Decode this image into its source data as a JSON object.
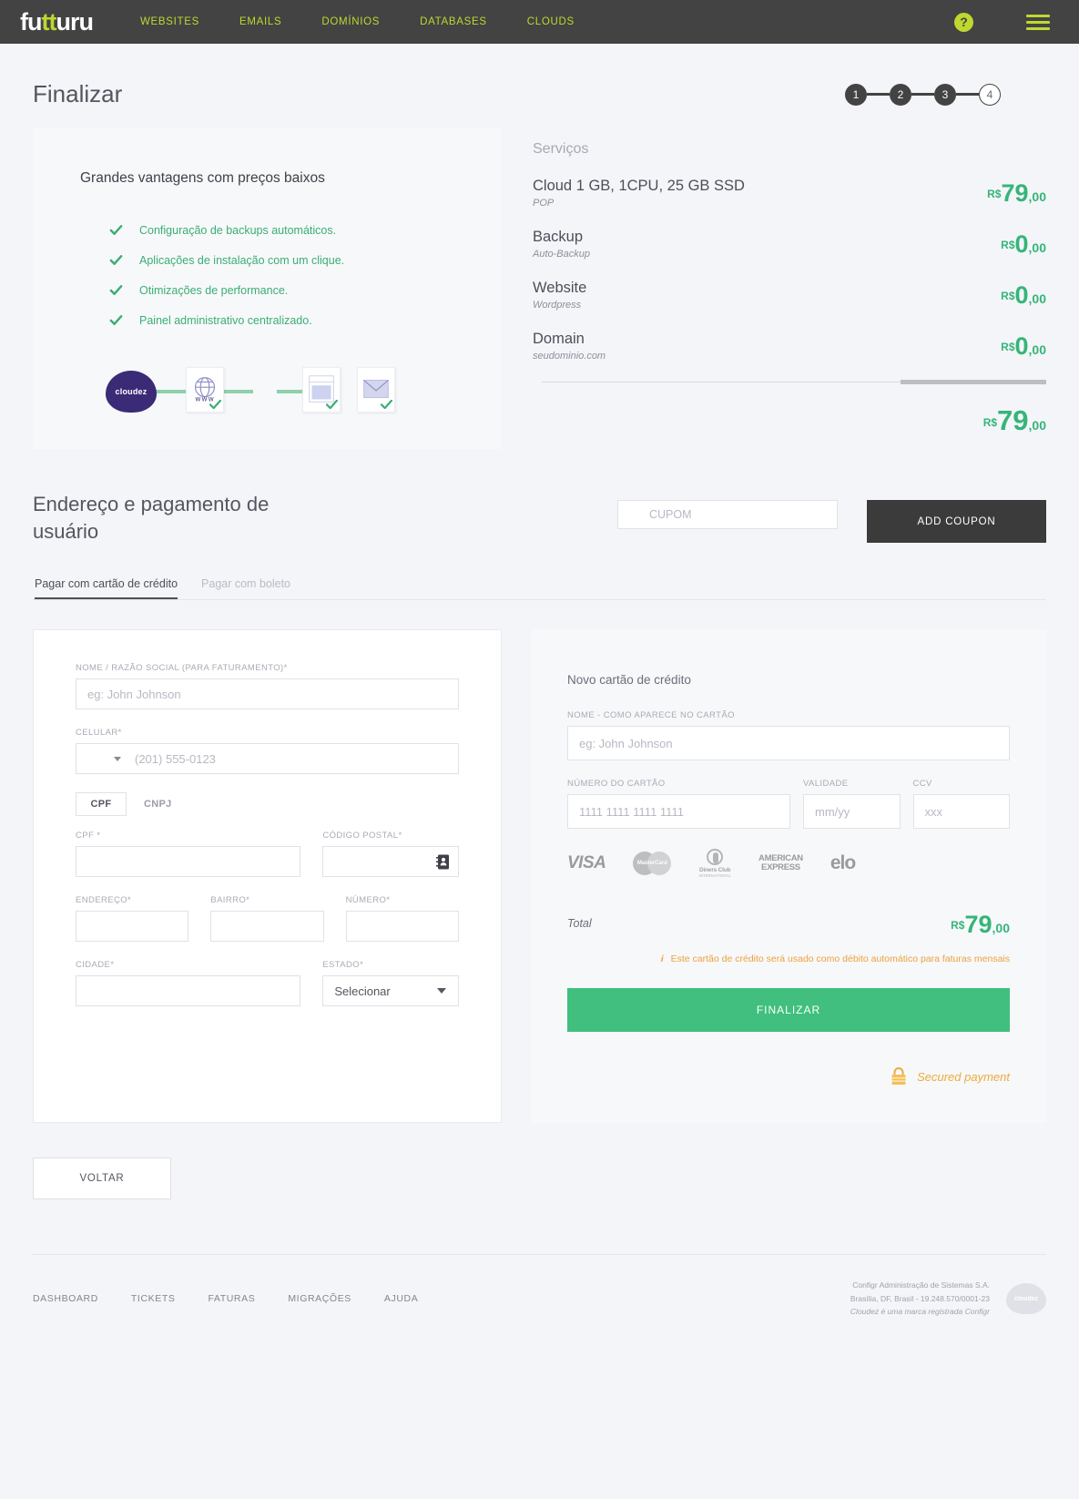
{
  "nav": {
    "logo_parts": {
      "a": "fu",
      "b": "tt",
      "c": "uru"
    },
    "links": [
      "WEBSITES",
      "EMAILS",
      "DOMÍNIOS",
      "DATABASES",
      "CLOUDS"
    ],
    "help_glyph": "?"
  },
  "page": {
    "title": "Finalizar",
    "steps": [
      "1",
      "2",
      "3",
      "4"
    ],
    "active_steps": 3
  },
  "promo": {
    "heading": "Grandes vantagens com preços baixos",
    "advantages": [
      "Configuração de backups automáticos.",
      "Aplicações de instalação com um clique.",
      "Otimizações de performance.",
      "Painel administrativo centralizado."
    ],
    "diagram": {
      "cloud_label": "cloudez",
      "www_label": "www"
    }
  },
  "services": {
    "heading": "Serviços",
    "items": [
      {
        "name": "Cloud 1 GB, 1CPU, 25 GB SSD",
        "sub": "POP",
        "currency": "R$",
        "amount": "79",
        "cents": ",00"
      },
      {
        "name": "Backup",
        "sub": "Auto-Backup",
        "currency": "R$",
        "amount": "0",
        "cents": ",00"
      },
      {
        "name": "Website",
        "sub": "Wordpress",
        "currency": "R$",
        "amount": "0",
        "cents": ",00"
      },
      {
        "name": "Domain",
        "sub": "seudominio.com",
        "currency": "R$",
        "amount": "0",
        "cents": ",00"
      }
    ],
    "total": {
      "currency": "R$",
      "amount": "79",
      "cents": ",00"
    }
  },
  "section": {
    "title": "Endereço e pagamento de usuário",
    "coupon_placeholder": "CUPOM",
    "coupon_value": "",
    "add_coupon_label": "ADD COUPON"
  },
  "tabs": [
    {
      "label": "Pagar com cartão de crédito",
      "active": true
    },
    {
      "label": "Pagar com boleto",
      "active": false
    }
  ],
  "billing_form": {
    "name_label": "NOME / RAZÃO SOCIAL (PARA FATURAMENTO)*",
    "name_placeholder": "eg: John Johnson",
    "name_value": "",
    "phone_label": "CELULAR*",
    "phone_placeholder": "(201) 555-0123",
    "phone_value": "",
    "doc_toggle": {
      "selected": "CPF",
      "other": "CNPJ"
    },
    "cpf_label": "CPF *",
    "cpf_value": "",
    "postal_label": "CÓDIGO POSTAL*",
    "postal_value": "",
    "address_label": "ENDEREÇO*",
    "address_value": "",
    "district_label": "BAIRRO*",
    "district_value": "",
    "number_label": "NÚMERO*",
    "number_value": "",
    "city_label": "CIDADE*",
    "city_value": "",
    "state_label": "ESTADO*",
    "state_selected": "Selecionar"
  },
  "card_form": {
    "title": "Novo cartão de crédito",
    "holder_label": "NOME - COMO APARECE NO CARTÃO",
    "holder_placeholder": "eg: John Johnson",
    "holder_value": "",
    "number_label": "NÚMERO DO CARTÃO",
    "number_placeholder": "1111 1111 1111 1111",
    "number_value": "",
    "expiry_label": "VALIDADE",
    "expiry_placeholder": "mm/yy",
    "expiry_value": "",
    "ccv_label": "CCV",
    "ccv_placeholder": "xxx",
    "ccv_value": "",
    "brands": [
      "VISA",
      "MasterCard",
      "Diners Club INTERNATIONAL",
      "AMERICAN EXPRESS",
      "elo"
    ],
    "brand_texts": {
      "visa": "VISA",
      "mastercard": "MasterCard",
      "diners_name": "Diners Club",
      "diners_sub": "INTERNATIONAL",
      "amex_1": "AMERICAN",
      "amex_2": "EXPRESS",
      "elo": "elo"
    },
    "total_label": "Total",
    "total": {
      "currency": "R$",
      "amount": "79",
      "cents": ",00"
    },
    "notice": "Este cartão de crédito será usado como débito automático para faturas mensais",
    "notice_icon": "i",
    "submit_label": "FINALIZAR",
    "secured_label": "Secured payment"
  },
  "back_label": "VOLTAR",
  "footer": {
    "links": [
      "DASHBOARD",
      "TICKETS",
      "FATURAS",
      "MIGRAÇÕES",
      "AJUDA"
    ],
    "company": "Configr Administração de Sistemas S.A.",
    "address": "Brasília, DF, Brasil - 19.248.570/0001-23",
    "trademark": "Cloudez é uma marca registrada Configr",
    "logo_label": "cloudez"
  },
  "colors": {
    "nav_bg": "#434343",
    "lime": "#bfd730",
    "green": "#35b579",
    "button_green": "#40bf7e",
    "orange": "#eda13c",
    "purple": "#3b2a76"
  }
}
